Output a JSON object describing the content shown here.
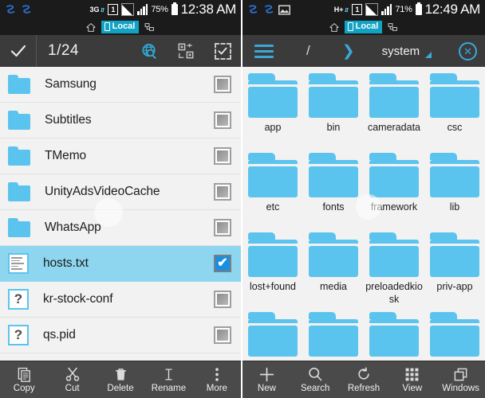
{
  "left_panel": {
    "status_bar": {
      "network_type": "3G",
      "sim_label": "1",
      "battery_percent": "75%",
      "time": "12:38 AM",
      "location_badge": "Local",
      "icons": [
        "app-logo-icon",
        "app-logo-icon",
        "home-icon",
        "network-share-icon",
        "signal-icon",
        "battery-icon"
      ]
    },
    "toolbar": {
      "check_icon": "checkmark-icon",
      "selection_count": "1/24",
      "icons": [
        "globe-search-icon",
        "scan-select-icon",
        "select-all-icon"
      ]
    },
    "files": [
      {
        "name": "Samsung",
        "type": "folder",
        "checked": false
      },
      {
        "name": "Subtitles",
        "type": "folder",
        "checked": false
      },
      {
        "name": "TMemo",
        "type": "folder",
        "checked": false
      },
      {
        "name": "UnityAdsVideoCache",
        "type": "folder",
        "checked": false
      },
      {
        "name": "WhatsApp",
        "type": "folder",
        "checked": false
      },
      {
        "name": "hosts.txt",
        "type": "text",
        "checked": true
      },
      {
        "name": "kr-stock-conf",
        "type": "unknown",
        "checked": false
      },
      {
        "name": "qs.pid",
        "type": "unknown",
        "checked": false
      }
    ],
    "bottom_bar": [
      {
        "label": "Copy",
        "icon": "copy-icon"
      },
      {
        "label": "Cut",
        "icon": "scissors-icon"
      },
      {
        "label": "Delete",
        "icon": "trash-icon"
      },
      {
        "label": "Rename",
        "icon": "text-cursor-icon"
      },
      {
        "label": "More",
        "icon": "more-vertical-icon"
      }
    ]
  },
  "right_panel": {
    "status_bar": {
      "network_type": "H+",
      "sim_label": "1",
      "battery_percent": "71%",
      "time": "12:49 AM",
      "location_badge": "Local",
      "icons": [
        "app-logo-icon",
        "app-logo-icon",
        "image-icon",
        "home-icon",
        "network-share-icon",
        "signal-icon",
        "battery-icon"
      ]
    },
    "toolbar": {
      "menu_icon": "hamburger-menu-icon",
      "path_root": "/",
      "path_separator": "❯",
      "current_folder": "system",
      "dropdown_icon": "triangle-down-icon",
      "close_icon": "close-circle-icon"
    },
    "folders": [
      {
        "name": "app"
      },
      {
        "name": "bin"
      },
      {
        "name": "cameradata"
      },
      {
        "name": "csc"
      },
      {
        "name": "etc"
      },
      {
        "name": "fonts"
      },
      {
        "name": "framework"
      },
      {
        "name": "lib"
      },
      {
        "name": "lost+found"
      },
      {
        "name": "media"
      },
      {
        "name": "preloadedkiosk"
      },
      {
        "name": "priv-app"
      },
      {
        "name": ""
      },
      {
        "name": ""
      },
      {
        "name": ""
      },
      {
        "name": ""
      }
    ],
    "bottom_bar": [
      {
        "label": "New",
        "icon": "plus-icon"
      },
      {
        "label": "Search",
        "icon": "search-icon"
      },
      {
        "label": "Refresh",
        "icon": "refresh-icon"
      },
      {
        "label": "View",
        "icon": "grid-view-icon"
      },
      {
        "label": "Windows",
        "icon": "windows-icon"
      }
    ]
  },
  "colors": {
    "folder_blue": "#5bc4ee",
    "accent_blue": "#3aa8d8",
    "selection_blue": "#8ed6f0",
    "badge_teal": "#12a3c4",
    "statusbar_bg": "#1b1b1b",
    "toolbar_bg": "#3b3b3b",
    "bottombar_bg": "#4a4a4a",
    "list_bg": "#f2f2f2"
  }
}
